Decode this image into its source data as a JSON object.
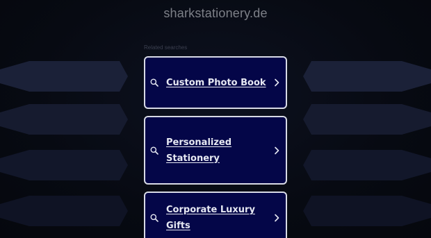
{
  "site": {
    "domain": "sharkstationery.de"
  },
  "related": {
    "heading": "Related searches",
    "links": [
      {
        "label": "Custom Photo Book"
      },
      {
        "label": "Personalized Stationery"
      },
      {
        "label": "Corporate Luxury Gifts"
      }
    ]
  },
  "colors": {
    "background": "#070a12",
    "card_fill": "#040648",
    "card_border": "#d8dae6",
    "card_text": "#e6e8f2",
    "deco_shape": "#1b2138"
  },
  "icons": {
    "search": "search-icon",
    "chevron": "chevron-right-icon"
  }
}
